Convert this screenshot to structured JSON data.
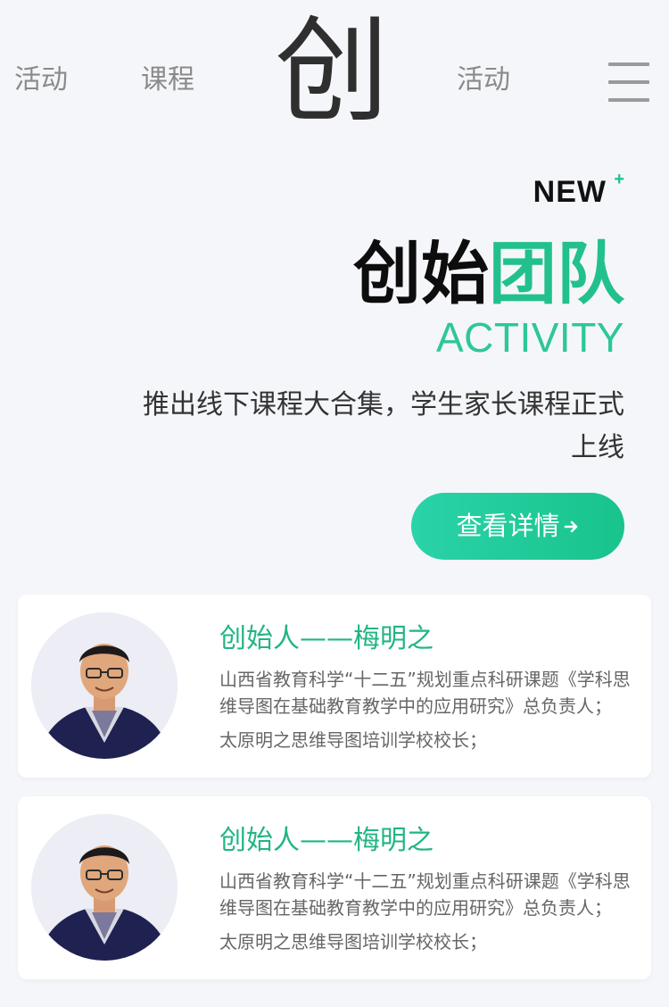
{
  "nav": {
    "left_links": [
      "活动",
      "课程"
    ],
    "logo_char": "创",
    "right_link": "活动",
    "menu_icon": "hamburger-menu-icon"
  },
  "hero": {
    "badge": "NEW",
    "badge_plus": "+",
    "title_black": "创始",
    "title_green": "团队",
    "subtitle": "ACTIVITY",
    "description": "推出线下课程大合集，学生家长课程正式上线",
    "cta_label": "查看详情",
    "cta_icon": "arrow-right-icon"
  },
  "cards": [
    {
      "title": "创始人——梅明之",
      "desc1": "山西省教育科学“十二五”规划重点科研课题《学科思维导图在基础教育教学中的应用研究》总负责人；",
      "desc2": "太原明之思维导图培训学校校长；"
    },
    {
      "title": "创始人——梅明之",
      "desc1": "山西省教育科学“十二五”规划重点科研课题《学科思维导图在基础教育教学中的应用研究》总负责人；",
      "desc2": "太原明之思维导图培训学校校长；"
    }
  ],
  "colors": {
    "accent_green": "#22c08d",
    "background": "#f5f6fa",
    "cta_gradient_start": "#2ad3a8",
    "cta_gradient_end": "#19c38c"
  }
}
